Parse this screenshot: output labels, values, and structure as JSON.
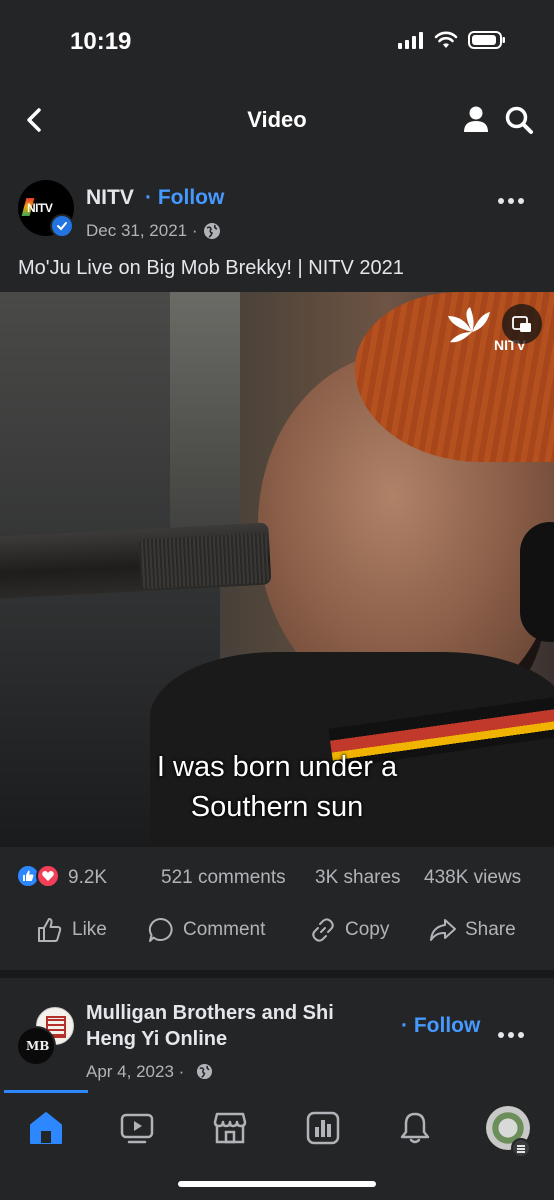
{
  "status": {
    "time": "10:19"
  },
  "nav": {
    "title": "Video"
  },
  "post": {
    "page_name": "NITV",
    "follow_label": "· Follow",
    "date": "Dec 31, 2021 ·",
    "title": "Mo'Ju Live on Big Mob Brekky! | NITV 2021",
    "avatar_text": "NITV",
    "video": {
      "caption_line1": "I was born under a",
      "caption_line2": "Southern sun",
      "watermark": "NITV"
    },
    "stats": {
      "reactions": "9.2K",
      "comments": "521 comments",
      "shares": "3K shares",
      "views": "438K views"
    },
    "actions": {
      "like": "Like",
      "comment": "Comment",
      "copy": "Copy",
      "share": "Share"
    }
  },
  "next_post": {
    "page_name": "Mulligan Brothers and Shi Heng Yi Online",
    "follow_label": "· Follow",
    "date": "Apr 4, 2023 ·",
    "avatar_text": "MB"
  },
  "tabbar": {
    "items": [
      {
        "name": "home",
        "active": true
      },
      {
        "name": "video",
        "active": false
      },
      {
        "name": "marketplace",
        "active": false
      },
      {
        "name": "feeds",
        "active": false
      },
      {
        "name": "notifications",
        "active": false
      },
      {
        "name": "profile",
        "active": false
      }
    ]
  },
  "colors": {
    "background": "#242526",
    "accent": "#2d88ff",
    "link": "#4599ff",
    "secondary_text": "#b0b3b8"
  }
}
